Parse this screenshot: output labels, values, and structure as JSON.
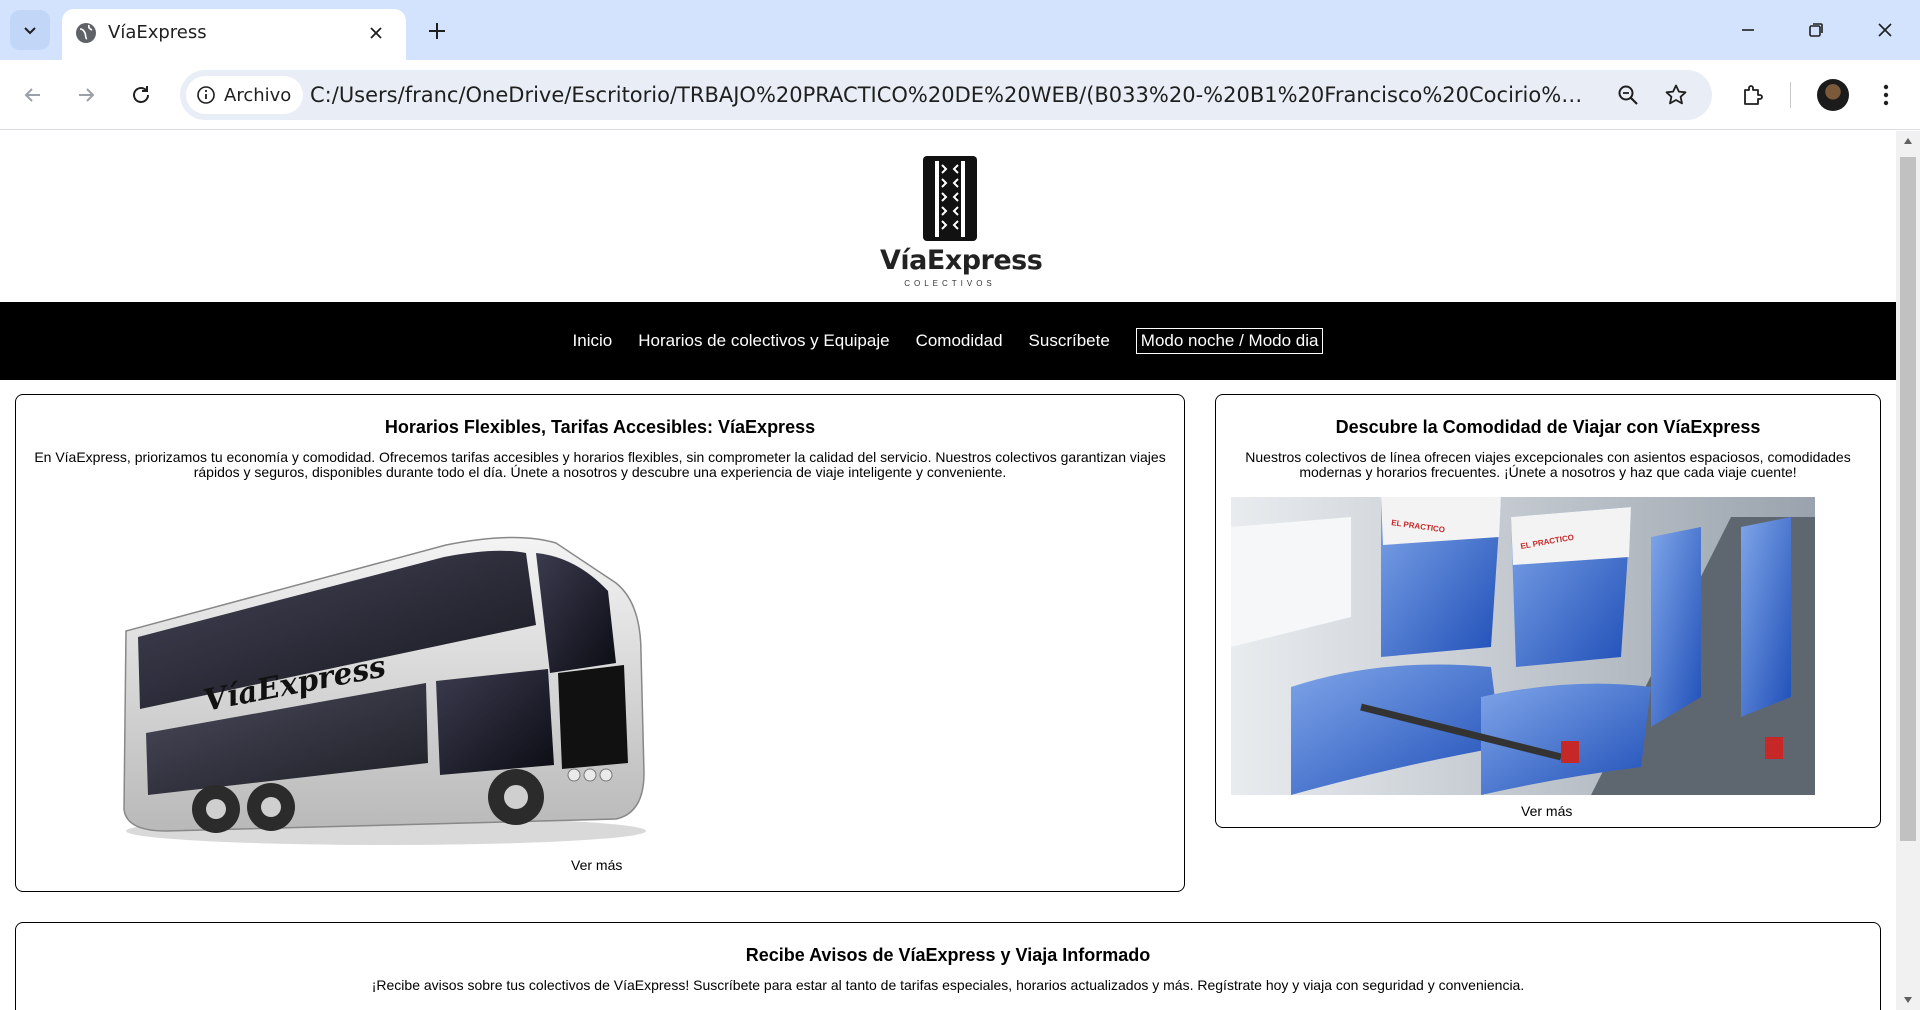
{
  "browser": {
    "tab_title": "VíaExpress",
    "security_chip": "Archivo",
    "url": "C:/Users/franc/OneDrive/Escritorio/TRBAJO%20PRACTICO%20DE%20WEB/(B033%20-%20B1%20Francisco%20Cocirio%20%20y%20Felipe..."
  },
  "site": {
    "logo_text": "VíaExpress",
    "logo_sub": "COLECTIVOS",
    "nav": {
      "inicio": "Inicio",
      "horarios": "Horarios de colectivos y Equipaje",
      "comodidad": "Comodidad",
      "suscribete": "Suscríbete",
      "modo": "Modo noche / Modo dia"
    }
  },
  "cards": {
    "horarios": {
      "title": "Horarios Flexibles, Tarifas Accesibles: VíaExpress",
      "text": "En VíaExpress, priorizamos tu economía y comodidad. Ofrecemos tarifas accesibles y horarios flexibles, sin comprometer la calidad del servicio. Nuestros colectivos garantizan viajes rápidos y seguros, disponibles durante todo el día. Únete a nosotros y descubre una experiencia de viaje inteligente y conveniente.",
      "bus_label": "VíaExpress",
      "link": "Ver más"
    },
    "comodidad": {
      "title": "Descubre la Comodidad de Viajar con VíaExpress",
      "text": "Nuestros colectivos de línea ofrecen viajes excepcionales con asientos espaciosos, comodidades modernas y horarios frecuentes. ¡Únete a nosotros y haz que cada viaje cuente!",
      "seat_label": "EL PRACTICO",
      "link": "Ver más"
    },
    "avisos": {
      "title": "Recibe Avisos de VíaExpress y Viaja Informado",
      "text": "¡Recibe avisos sobre tus colectivos de VíaExpress! Suscríbete para estar al tanto de tarifas especiales, horarios actualizados y más. Regístrate hoy y viaja con seguridad y conveniencia."
    }
  }
}
